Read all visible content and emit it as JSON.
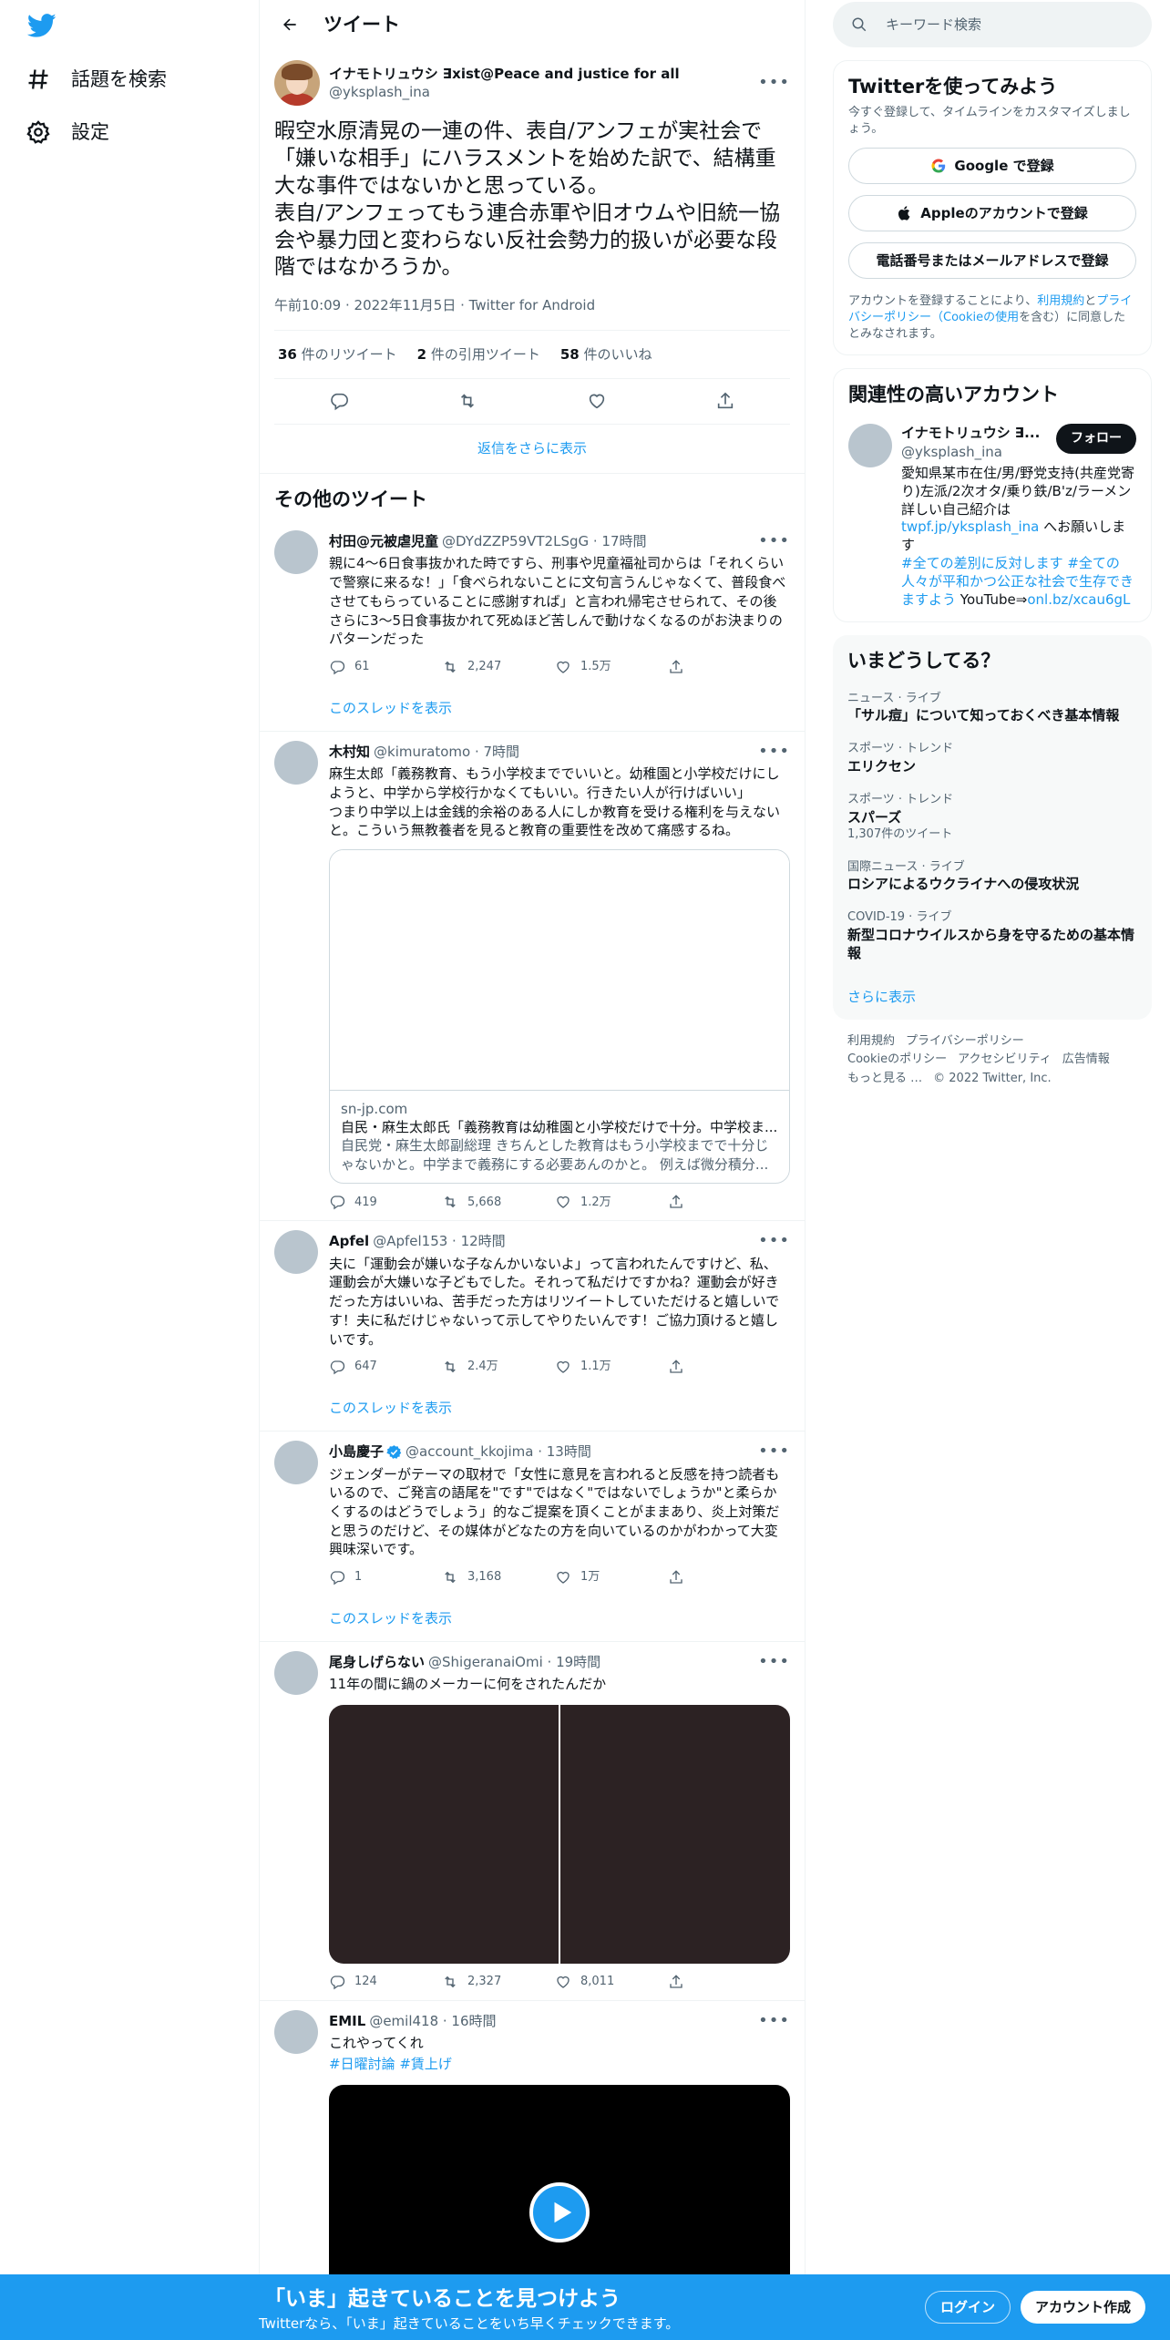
{
  "nav": {
    "explore": "話題を検索",
    "settings": "設定"
  },
  "header": {
    "title": "ツイート"
  },
  "main_tweet": {
    "name": "イナモトリュウシ ∃xist@Peace and justice for all",
    "handle": "@yksplash_ina",
    "text": "暇空水原清晃の一連の件、表自/アンフェが実社会で「嫌いな相手」にハラスメントを始めた訳で、結構重大な事件ではないかと思っている。\n表自/アンフェってもう連合赤軍や旧オウムや旧統一協会や暴力団と変わらない反社会勢力的扱いが必要な段階ではなかろうか。",
    "time": "午前10:09",
    "date": "2022年11月5日",
    "source": "Twitter for Android",
    "retweets": "36",
    "retweets_label": " 件のリツイート",
    "quotes": "2",
    "quotes_label": " 件の引用ツイート",
    "likes": "58",
    "likes_label": " 件のいいね"
  },
  "more_replies": "返信をさらに表示",
  "other_tweets_title": "その他のツイート",
  "show_thread": "このスレッドを表示",
  "tweets": [
    {
      "name": "村田@元被虐児童",
      "meta": "@DYdZZP59VT2LSgG · 17時間",
      "text": "親に4～6日食事抜かれた時ですら、刑事や児童福祉司からは「それくらいで警察に来るな！」「食べられないことに文句言うんじゃなくて、普段食べさせてもらっていることに感謝すれば」と言われ帰宅させられて、その後さらに3～5日食事抜かれて死ぬほど苦しんで動けなくなるのがお決まりのパターンだった",
      "replies": "61",
      "retweets": "2,247",
      "likes": "1.5万"
    },
    {
      "name": "木村知",
      "meta": "@kimuratomo · 7時間",
      "text": "麻生太郎「義務教育、もう小学校まででいいと。幼稚園と小学校だけにしようと、中学から学校行かなくてもいい。行きたい人が行けばいい」\nつまり中学以上は金銭的余裕のある人にしか教育を受ける権利を与えないと。こういう無教養者を見ると教育の重要性を改めて痛感するね。",
      "card_domain": "sn-jp.com",
      "card_title": "自民・麻生太郎氏「義務教育は幼稚園と小学校だけで十分。中学校ま...",
      "card_desc": "自民党・麻生太郎副総理 きちんとした教育はもう小学校までで十分じゃないかと。中学まで義務にする必要あんのかと。 例えば微分積分...",
      "replies": "419",
      "retweets": "5,668",
      "likes": "1.2万"
    },
    {
      "name": "Apfel",
      "meta": "@Apfel153 · 12時間",
      "text": "夫に「運動会が嫌いな子なんかいないよ」って言われたんですけど、私、運動会が大嫌いな子どもでした。それって私だけですかね？運動会が好きだった方はいいね、苦手だった方はリツイートしていただけると嬉しいです！夫に私だけじゃないって示してやりたいんです！ご協力頂けると嬉しいです。",
      "replies": "647",
      "retweets": "2.4万",
      "likes": "1.1万"
    },
    {
      "name": "小島慶子",
      "meta": "@account_kkojima · 13時間",
      "text": "ジェンダーがテーマの取材で「女性に意見を言われると反感を持つ読者もいるので、ご発言の語尾を\"です\"ではなく\"ではないでしょうか\"と柔らかくするのはどうでしょう」的なご提案を頂くことがままあり、炎上対策だと思うのだけど、その媒体がどなたの方を向いているのかがわかって大変興味深いです。",
      "replies": "1",
      "retweets": "3,168",
      "likes": "1万"
    },
    {
      "name": "尾身しげらない",
      "meta": "@ShigeranaiOmi · 19時間",
      "text": "11年の間に鍋のメーカーに何をされたんだか",
      "replies": "124",
      "retweets": "2,327",
      "likes": "8,011"
    },
    {
      "name": "EMIL",
      "meta": "@emil418 · 16時間",
      "text": "これやってくれ",
      "hashtags": "#日曜討論 #賃上げ"
    }
  ],
  "right": {
    "search_placeholder": "キーワード検索",
    "signup_title": "Twitterを使ってみよう",
    "signup_sub": "今すぐ登録して、タイムラインをカスタマイズしましょう。",
    "google_btn": "Google で登録",
    "apple_btn": "Appleのアカウントで登録",
    "phone_btn": "電話番号またはメールアドレスで登録",
    "legal_pre": "アカウントを登録することにより、",
    "legal_link1": "利用規約",
    "legal_mid": "と",
    "legal_link2": "プライバシーポリシー（Cookieの使用",
    "legal_post": "を含む）に同意したとみなされます。",
    "related_title": "関連性の高いアカウント",
    "acct_name": "イナモトリュウシ ∃...",
    "acct_handle": "@yksplash_ina",
    "follow": "フォロー",
    "bio_1": "愛知県某市在住/男/野党支持(共産党寄り)左派/2次オタ/乗り鉄/B'z/ラーメン",
    "bio_2": "詳しい自己紹介は",
    "bio_link1": "twpf.jp/yksplash_ina",
    "bio_3": " へお願いします",
    "bio_link2": "#全ての差別に反対します #全ての人々が平和かつ公正な社会で生存できますよう",
    "bio_4": " YouTube⇒",
    "bio_link3": "onl.bz/xcau6gL",
    "trends_title": "いまどうしてる？",
    "trends": [
      {
        "cat": "ニュース · ライブ",
        "title": "「サル痘」について知っておくべき基本情報",
        "count": ""
      },
      {
        "cat": "スポーツ · トレンド",
        "title": "エリクセン",
        "count": ""
      },
      {
        "cat": "スポーツ · トレンド",
        "title": "スパーズ",
        "count": "1,307件のツイート"
      },
      {
        "cat": "国際ニュース · ライブ",
        "title": "ロシアによるウクライナへの侵攻状況",
        "count": ""
      },
      {
        "cat": "COVID-19 · ライブ",
        "title": "新型コロナウイルスから身を守るための基本情報",
        "count": ""
      }
    ],
    "show_more": "さらに表示",
    "footer": [
      "利用規約",
      "プライバシーポリシー",
      "Cookieのポリシー",
      "アクセシビリティ",
      "広告情報",
      "もっと見る …",
      "© 2022 Twitter, Inc."
    ]
  },
  "bottom": {
    "title": "「いま」起きていることを見つけよう",
    "sub": "Twitterなら、「いま」起きていることをいち早くチェックできます。",
    "login": "ログイン",
    "signup": "アカウント作成"
  },
  "colors": {
    "accent": "#1d9bf0",
    "text": "#0f1419",
    "muted": "#536471"
  }
}
